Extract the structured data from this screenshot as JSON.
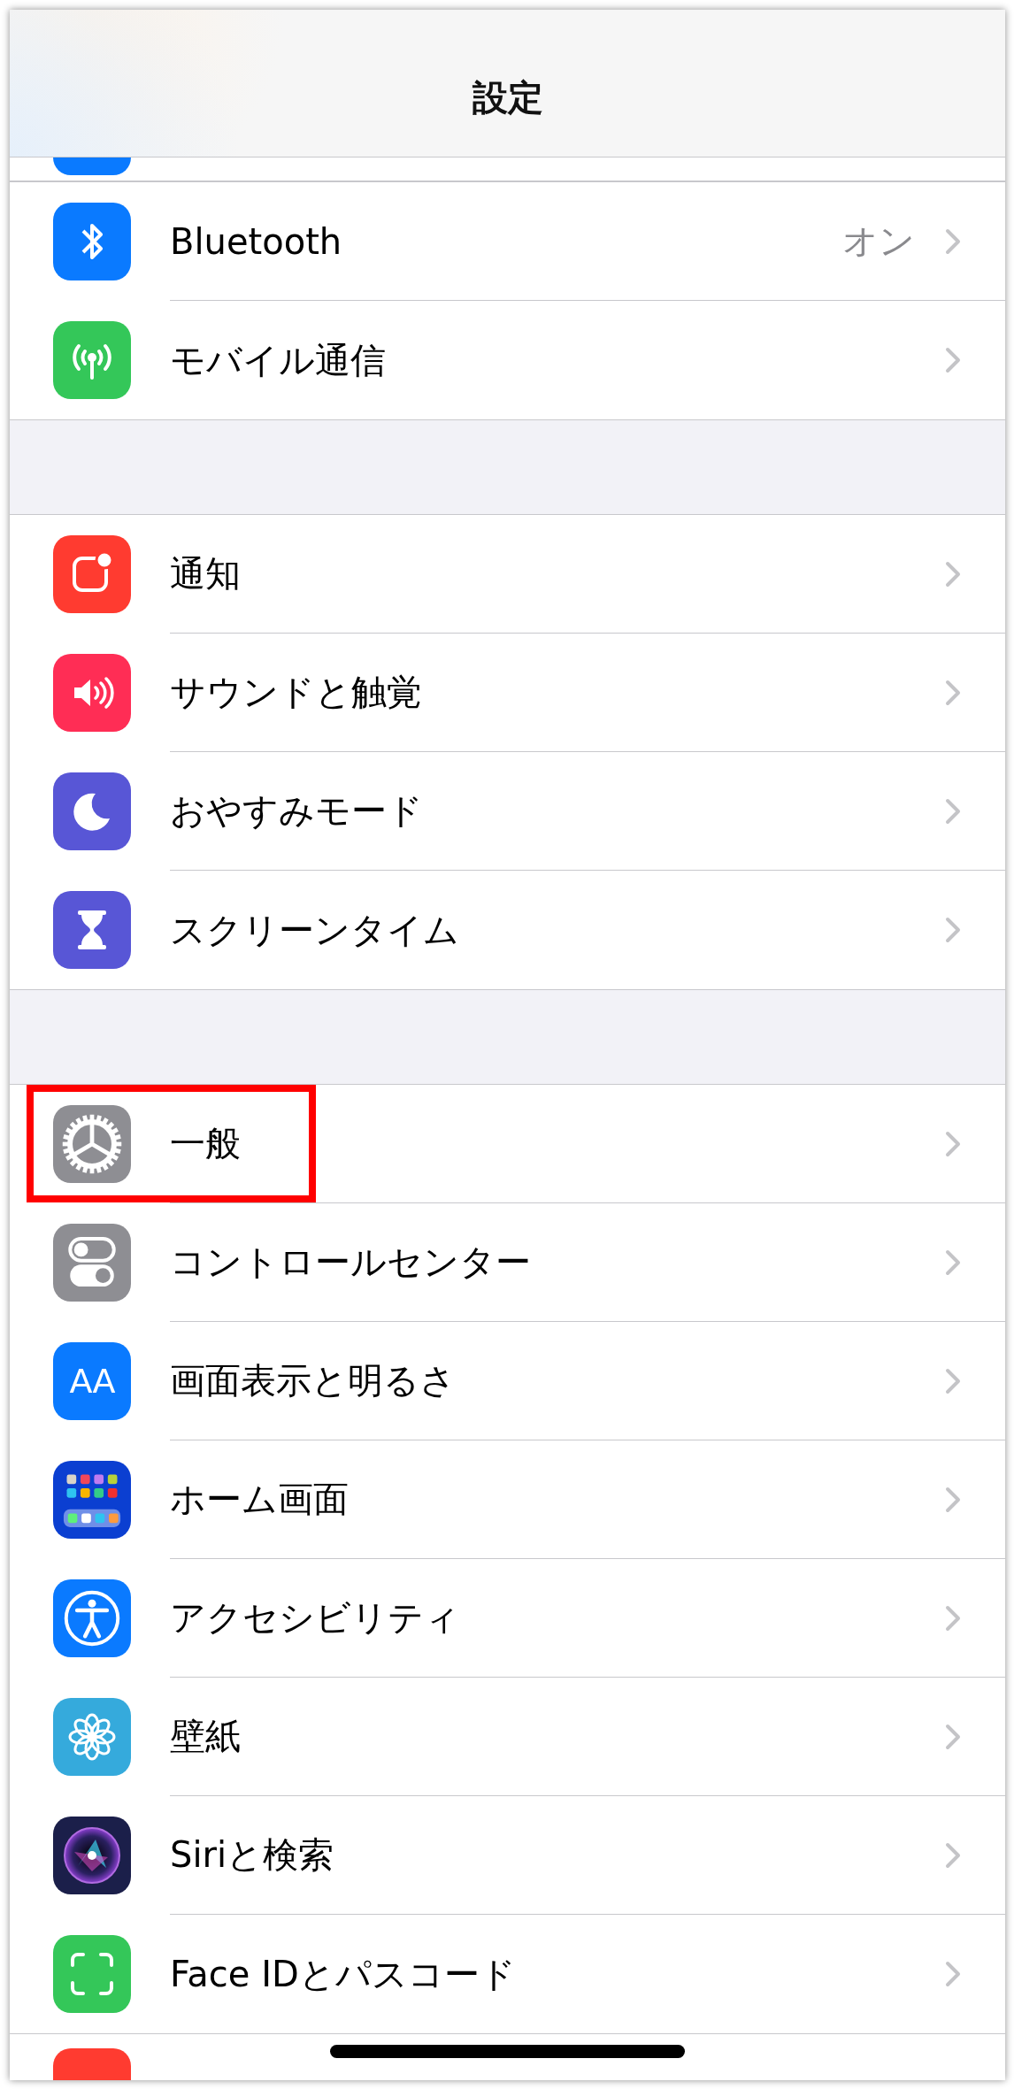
{
  "title": "設定",
  "sections": [
    {
      "items": [
        {
          "kind": "bluetooth",
          "label": "Bluetooth",
          "value": "オン"
        },
        {
          "kind": "cellular",
          "label": "モバイル通信"
        }
      ]
    },
    {
      "items": [
        {
          "kind": "notifications",
          "label": "通知"
        },
        {
          "kind": "sounds",
          "label": "サウンドと触覚"
        },
        {
          "kind": "focus",
          "label": "おやすみモード"
        },
        {
          "kind": "screentime",
          "label": "スクリーンタイム"
        }
      ]
    },
    {
      "items": [
        {
          "kind": "general",
          "label": "一般",
          "highlighted": true
        },
        {
          "kind": "control",
          "label": "コントロールセンター"
        },
        {
          "kind": "display",
          "label": "画面表示と明るさ",
          "glyph": "AA"
        },
        {
          "kind": "home",
          "label": "ホーム画面"
        },
        {
          "kind": "accessibility",
          "label": "アクセシビリティ"
        },
        {
          "kind": "wallpaper",
          "label": "壁紙"
        },
        {
          "kind": "siri",
          "label": "Siriと検索"
        },
        {
          "kind": "faceid",
          "label": "Face IDとパスコード"
        }
      ]
    }
  ]
}
